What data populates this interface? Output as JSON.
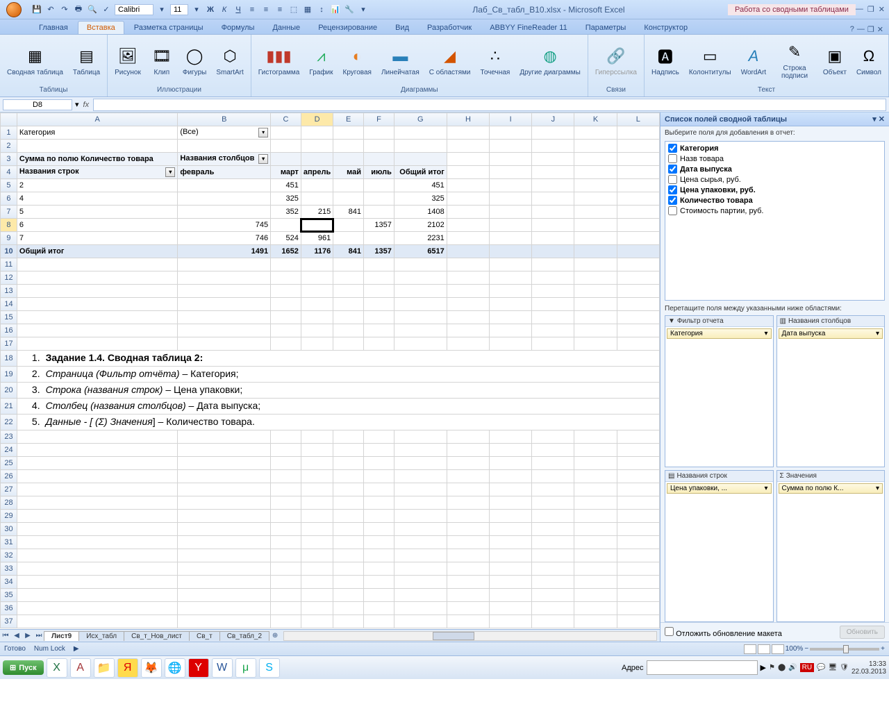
{
  "title": "Лаб_Св_табл_В10.xlsx - Microsoft Excel",
  "context_tab": "Работа со сводными таблицами",
  "qat_font": "Calibri",
  "qat_font_size": "11",
  "tabs": [
    "Главная",
    "Вставка",
    "Разметка страницы",
    "Формулы",
    "Данные",
    "Рецензирование",
    "Вид",
    "Разработчик",
    "ABBYY FineReader 11",
    "Параметры",
    "Конструктор"
  ],
  "active_tab": 1,
  "ribbon_groups": {
    "tables": {
      "label": "Таблицы",
      "items": [
        "Сводная\nтаблица",
        "Таблица"
      ]
    },
    "illustrations": {
      "label": "Иллюстрации",
      "items": [
        "Рисунок",
        "Клип",
        "Фигуры",
        "SmartArt"
      ]
    },
    "charts": {
      "label": "Диаграммы",
      "items": [
        "Гистограмма",
        "График",
        "Круговая",
        "Линейчатая",
        "С\nобластями",
        "Точечная",
        "Другие\nдиаграммы"
      ]
    },
    "links": {
      "label": "Связи",
      "items": [
        "Гиперссылка"
      ]
    },
    "text": {
      "label": "Текст",
      "items": [
        "Надпись",
        "Колонтитулы",
        "WordArt",
        "Строка\nподписи",
        "Объект",
        "Символ"
      ]
    }
  },
  "name_box": "D8",
  "columns": [
    "A",
    "B",
    "C",
    "D",
    "E",
    "F",
    "G",
    "H",
    "I",
    "J",
    "K",
    "L"
  ],
  "sheet": {
    "r1": {
      "A": "Категория",
      "B": "(Все)"
    },
    "r3": {
      "A": "Сумма по полю Количество товара",
      "B": "Названия столбцов"
    },
    "r4": {
      "A": "Названия строк",
      "B": "февраль",
      "C": "март",
      "D": "апрель",
      "E": "май",
      "F": "июль",
      "G": "Общий итог"
    },
    "r5": {
      "A": "2",
      "C": "451",
      "G": "451"
    },
    "r6": {
      "A": "4",
      "C": "325",
      "G": "325"
    },
    "r7": {
      "A": "5",
      "C": "352",
      "D": "215",
      "E": "841",
      "G": "1408"
    },
    "r8": {
      "A": "6",
      "B": "745",
      "F": "1357",
      "G": "2102"
    },
    "r9": {
      "A": "7",
      "B": "746",
      "C": "524",
      "D": "961",
      "G": "2231"
    },
    "r10": {
      "A": "Общий итог",
      "B": "1491",
      "C": "1652",
      "D": "1176",
      "E": "841",
      "F": "1357",
      "G": "6517"
    }
  },
  "task": {
    "l1_num": "1.",
    "l1_a": "Задание 1.4. Сводная таблица 2:",
    "l2_num": "2.",
    "l2_a": "Страница (Фильтр отчёта)",
    "l2_b": " – Категория;",
    "l3_num": "3.",
    "l3_a": "Строка (названия строк)",
    "l3_b": " – Цена упаковки;",
    "l4_num": "4.",
    "l4_a": "Столбец (названия столбцов)",
    "l4_b": " – Дата выпуска;",
    "l5_num": "5.",
    "l5_a": "Данные - [ (Σ) Значения",
    "l5_b": "] – Количество товара."
  },
  "sheet_tabs": [
    "Лист9",
    "Исх_табл",
    "Св_т_Нов_лист",
    "Св_т",
    "Св_табл_2"
  ],
  "pivot": {
    "title": "Список полей сводной таблицы",
    "hint": "Выберите поля для добавления в отчет:",
    "fields": [
      {
        "name": "Категория",
        "checked": true
      },
      {
        "name": "Назв товара",
        "checked": false
      },
      {
        "name": "Дата выпуска",
        "checked": true
      },
      {
        "name": "Цена сырья, руб.",
        "checked": false
      },
      {
        "name": "Цена упаковки, руб.",
        "checked": true
      },
      {
        "name": "Количество товара",
        "checked": true
      },
      {
        "name": "Стоимость партии, руб.",
        "checked": false
      }
    ],
    "drag_hint": "Перетащите поля между указанными ниже областями:",
    "areas": {
      "filter": {
        "label": "Фильтр отчета",
        "item": "Категория"
      },
      "columns": {
        "label": "Названия столбцов",
        "item": "Дата выпуска"
      },
      "rows": {
        "label": "Названия строк",
        "item": "Цена упаковки, ..."
      },
      "values": {
        "label": "Значения",
        "item": "Сумма по полю К..."
      }
    },
    "defer": "Отложить обновление макета",
    "update": "Обновить"
  },
  "status": {
    "ready": "Готово",
    "numlock": "Num Lock",
    "zoom": "100%"
  },
  "taskbar": {
    "start": "Пуск",
    "addr_label": "Адрес",
    "addr_placeholder": "",
    "clock_time": "13:33",
    "clock_date": "22.03.2013"
  }
}
